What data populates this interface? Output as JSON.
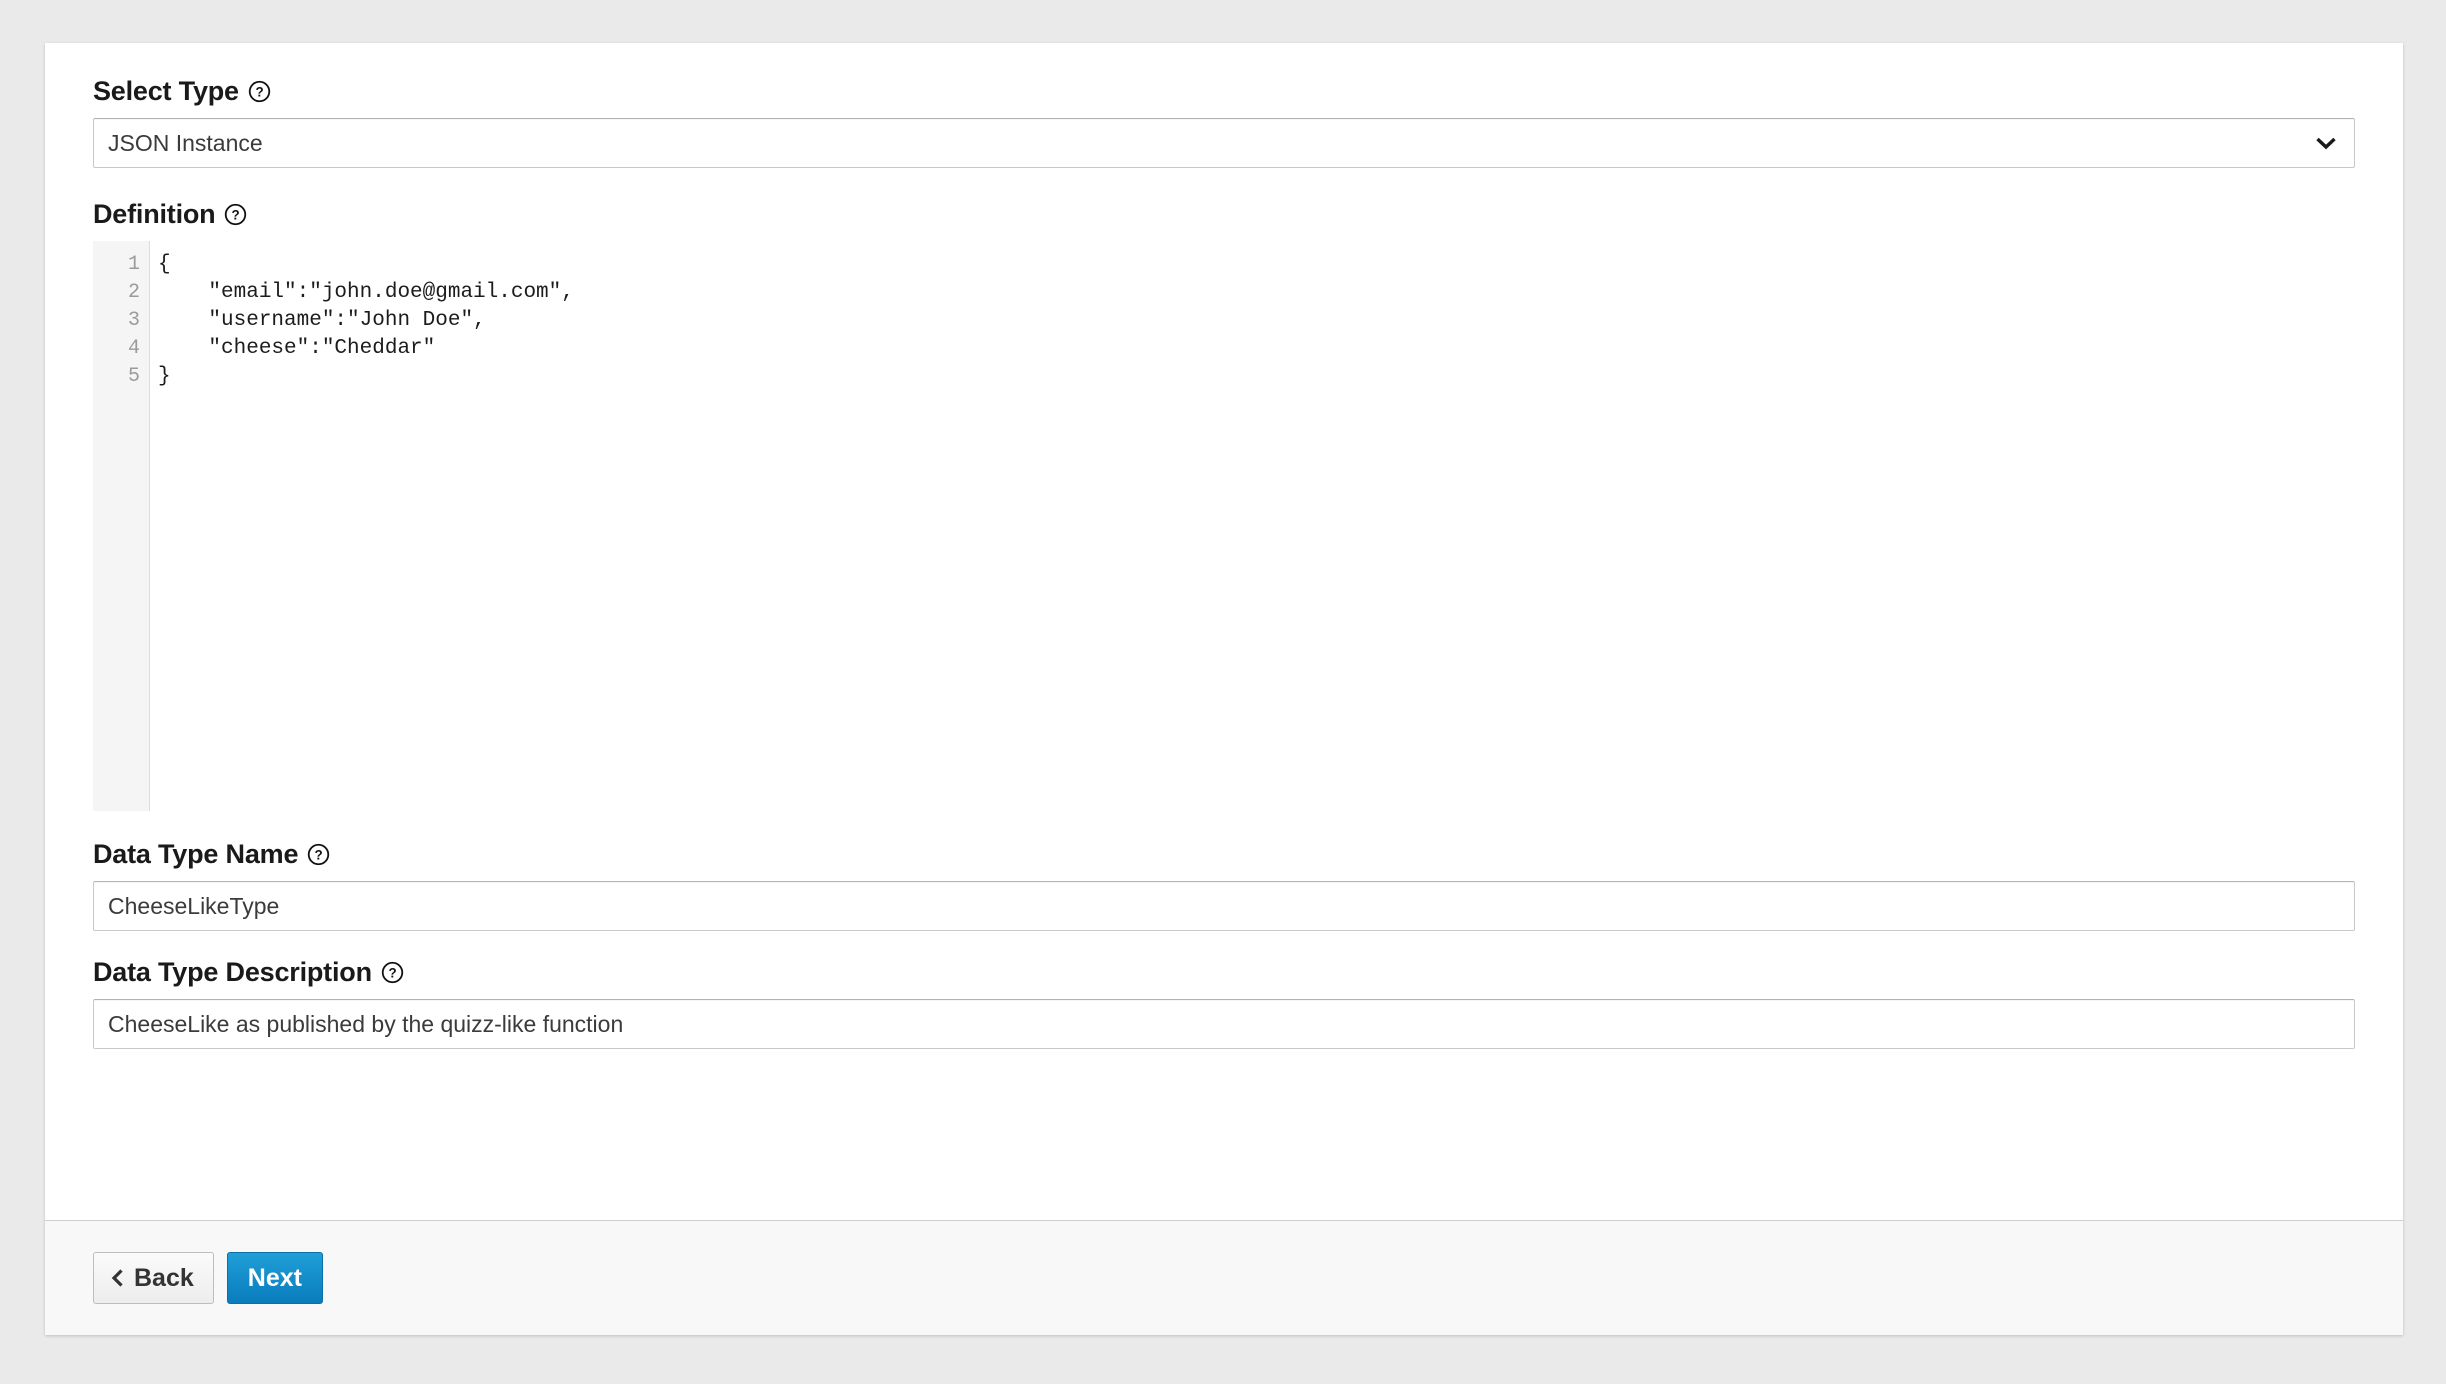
{
  "form": {
    "select_type": {
      "label": "Select Type",
      "help_icon": "question-circle-icon",
      "selected_value": "JSON Instance",
      "options": [
        "JSON Instance"
      ],
      "chevron_icon": "chevron-down-icon"
    },
    "definition": {
      "label": "Definition",
      "help_icon": "question-circle-icon",
      "line_numbers": [
        "1",
        "2",
        "3",
        "4",
        "5"
      ],
      "code_lines": [
        "{",
        "    \"email\":\"john.doe@gmail.com\",",
        "    \"username\":\"John Doe\",",
        "    \"cheese\":\"Cheddar\"",
        "}"
      ]
    },
    "data_type_name": {
      "label": "Data Type Name",
      "help_icon": "question-circle-icon",
      "value": "CheeseLikeType"
    },
    "data_type_description": {
      "label": "Data Type Description",
      "help_icon": "question-circle-icon",
      "value": "CheeseLike as published by the quizz-like function"
    }
  },
  "footer": {
    "back_label": "Back",
    "back_icon": "chevron-left-icon",
    "next_label": "Next"
  },
  "colors": {
    "page_background": "#eaeaea",
    "card_background": "#ffffff",
    "footer_background": "#f8f8f8",
    "primary_button": "#0a7cbd",
    "primary_button_light": "#1f9fd8",
    "gutter_background": "#f5f5f5",
    "label_text": "#1a1a1a",
    "input_text": "#3b3b3b",
    "line_number_text": "#9b9b9b"
  }
}
